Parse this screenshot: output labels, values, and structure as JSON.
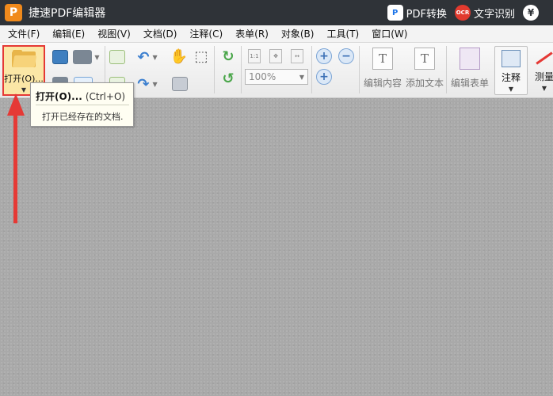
{
  "app": {
    "logo_letter": "P",
    "title": "捷速PDF编辑器"
  },
  "title_actions": {
    "pdf_convert": {
      "icon_text": "P",
      "label": "PDF转换"
    },
    "ocr": {
      "icon_text": "OCR",
      "label": "文字识别"
    },
    "yen": {
      "icon_text": "¥"
    }
  },
  "menu": [
    "文件(F)",
    "编辑(E)",
    "视图(V)",
    "文档(D)",
    "注释(C)",
    "表单(R)",
    "对象(B)",
    "工具(T)",
    "窗口(W)"
  ],
  "toolbar": {
    "open_label": "打开(O)...",
    "view_icons": [
      "1:1",
      "",
      ""
    ],
    "zoom_value": "100%",
    "edit_content": {
      "icon": "T",
      "label": "编辑内容"
    },
    "add_text": {
      "icon": "T",
      "label": "添加文本"
    },
    "edit_form": {
      "label": "编辑表单"
    },
    "annotate_label": "注释",
    "measure_label": "测量"
  },
  "tooltip": {
    "title": "打开(O)...",
    "shortcut": "(Ctrl+O)",
    "description": "打开已经存在的文档."
  },
  "colors": {
    "titlebar": "#2f3338",
    "highlight": "#e53935",
    "accent": "#f08a1c"
  }
}
